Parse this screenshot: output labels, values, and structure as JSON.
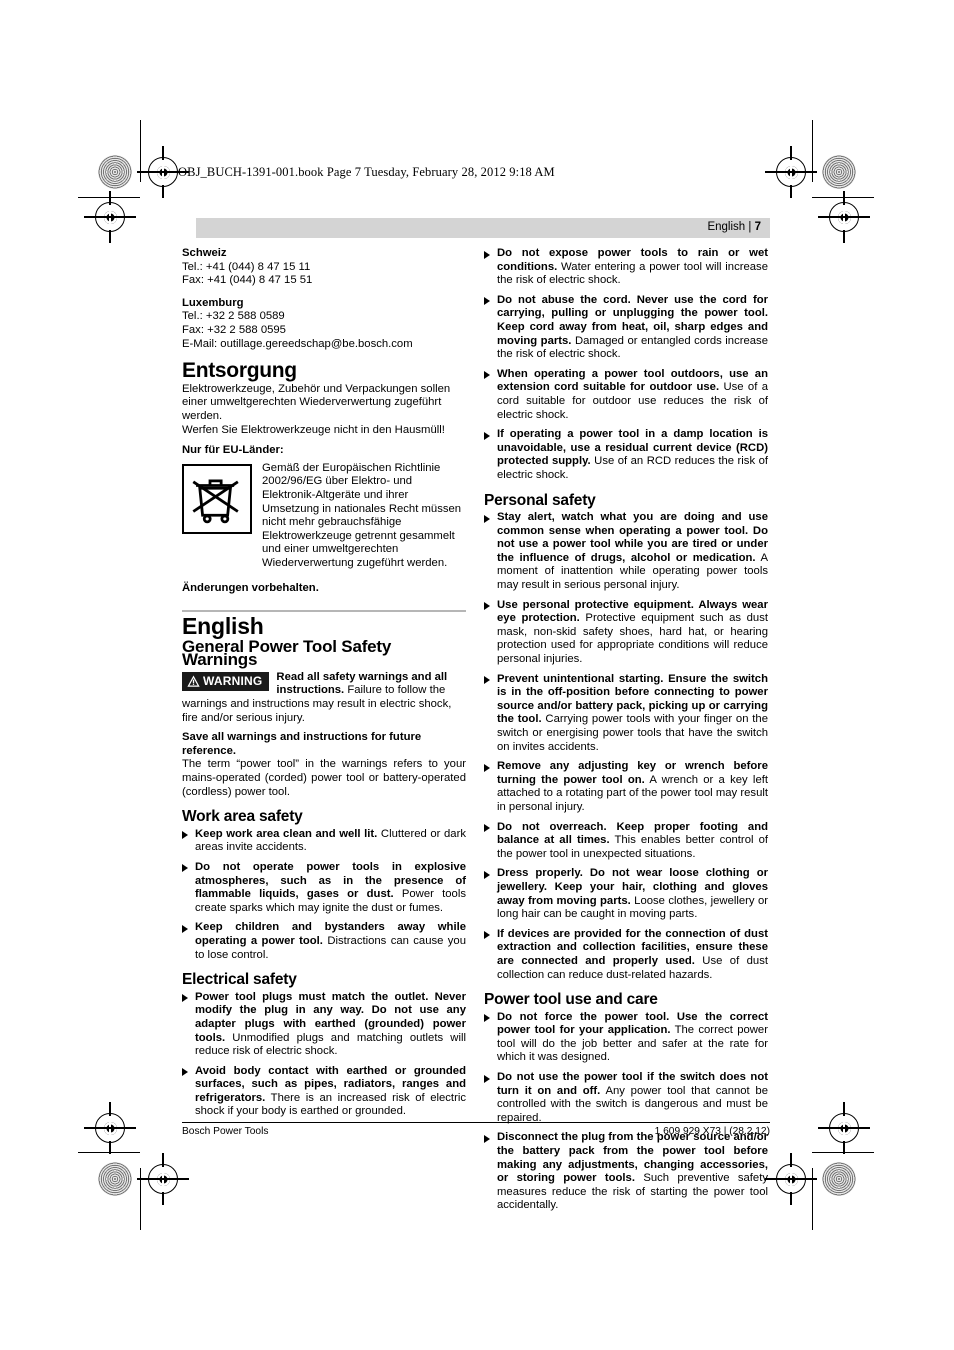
{
  "print_marks": {
    "file_label": "OBJ_BUCH-1391-001.book  Page 7  Tuesday, February 28, 2012  9:18 AM"
  },
  "header": {
    "language": "English",
    "separator": "|",
    "page_number": "7"
  },
  "footer": {
    "left": "Bosch Power Tools",
    "right": "1 609 929 X73 | (28.2.12)"
  },
  "left_column": {
    "contacts": [
      {
        "name": "Schweiz",
        "lines": [
          "Tel.: +41 (044) 8 47 15 11",
          "Fax: +41 (044) 8 47 15 51"
        ]
      },
      {
        "name": "Luxemburg",
        "lines": [
          "Tel.: +32 2 588 0589",
          "Fax: +32 2 588 0595",
          "E-Mail: outillage.gereedschap@be.bosch.com"
        ]
      }
    ],
    "entsorgung": {
      "heading": "Entsorgung",
      "paragraphs": [
        "Elektrowerkzeuge, Zubehör und Verpackungen sollen einer umweltgerechten Wiederverwertung zugeführt werden.",
        "Werfen Sie Elektrowerkzeuge nicht in den Hausmüll!"
      ],
      "eu_heading": "Nur für EU-Länder:",
      "eu_icon_name": "crossed-out-wheeled-bin-icon",
      "eu_text": "Gemäß der Europäischen Richtlinie 2002/96/EG über Elektro- und Elektronik-Altgeräte und ihrer Umsetzung in nationales Recht müssen nicht mehr gebrauchsfähige Elektrowerkzeuge getrennt gesammelt und einer umweltgerechten Wiederverwertung zugeführt werden.",
      "disclaimer": "Änderungen vorbehalten."
    },
    "english": {
      "language_heading": "English",
      "section_heading": "General Power Tool Safety Warnings",
      "warning_badge": "WARNING",
      "warning_lead": "Read all safety warnings and all instructions.",
      "warning_body": " Failure to follow the warnings and instructions may result in electric shock, fire and/or serious injury.",
      "save_lead": "Save all warnings and instructions for future reference.",
      "term_paragraph": "The term “power tool” in the warnings refers to your mains-operated (corded) power tool or battery-operated (cordless) power tool."
    },
    "work_area_safety": {
      "heading": "Work area safety",
      "items": [
        {
          "lead": "Keep work area clean and well lit.",
          "body": " Cluttered or dark areas invite accidents."
        },
        {
          "lead": "Do not operate power tools in explosive atmospheres, such as in the presence of flammable liquids, gases or dust.",
          "body": " Power tools create sparks which may ignite the dust or fumes."
        },
        {
          "lead": "Keep children and bystanders away while operating a power tool.",
          "body": " Distractions can cause you to lose control."
        }
      ]
    },
    "electrical_safety": {
      "heading": "Electrical safety",
      "items": [
        {
          "lead": "Power tool plugs must match the outlet. Never modify the plug in any way. Do not use any adapter plugs with earthed (grounded) power tools.",
          "body": " Unmodified plugs and matching outlets will reduce risk of electric shock."
        },
        {
          "lead": "Avoid body contact with earthed or grounded surfaces, such as pipes, radiators, ranges and refrigerators.",
          "body": " There is an increased risk of electric shock if your body is earthed or grounded."
        }
      ]
    }
  },
  "right_column": {
    "electrical_safety_cont": {
      "items": [
        {
          "lead": "Do not expose power tools to rain or wet conditions.",
          "body": " Water entering a power tool will increase the risk of electric shock."
        },
        {
          "lead": "Do not abuse the cord. Never use the cord for carrying, pulling or unplugging the power tool. Keep cord away from heat, oil, sharp edges and moving parts.",
          "body": " Damaged or entangled cords increase the risk of electric shock."
        },
        {
          "lead": "When operating a power tool outdoors, use an extension cord suitable for outdoor use.",
          "body": " Use of a cord suitable for outdoor use reduces the risk of electric shock."
        },
        {
          "lead": "If operating a power tool in a damp location is unavoidable, use a residual current device (RCD) protected supply.",
          "body": " Use of an RCD reduces the risk of electric shock."
        }
      ]
    },
    "personal_safety": {
      "heading": "Personal safety",
      "items": [
        {
          "lead": "Stay alert, watch what you are doing and use common sense when operating a power tool. Do not use a power tool while you are tired or under the influence of drugs, alcohol or medication.",
          "body": " A moment of inattention while operating power tools may result in serious personal injury."
        },
        {
          "lead": "Use personal protective equipment. Always wear eye protection.",
          "body": " Protective equipment such as dust mask, non-skid safety shoes, hard hat, or hearing protection used for appropriate conditions will reduce personal injuries."
        },
        {
          "lead": "Prevent unintentional starting. Ensure the switch is in the off-position before connecting to power source and/or battery pack, picking up or carrying the tool.",
          "body": " Carrying power tools with your finger on the switch or energising power tools that have the switch on invites accidents."
        },
        {
          "lead": "Remove any adjusting key or wrench before turning the power tool on.",
          "body": " A wrench or a key left attached to a rotating part of the power tool may result in personal injury."
        },
        {
          "lead": "Do not overreach. Keep proper footing and balance at all times.",
          "body": " This enables better control of the power tool in unexpected situations."
        },
        {
          "lead": "Dress properly. Do not wear loose clothing or jewellery. Keep your hair, clothing and gloves away from moving parts.",
          "body": " Loose clothes, jewellery or long hair can be caught in moving parts."
        },
        {
          "lead": "If devices are provided for the connection of dust extraction and collection facilities, ensure these are connected and properly used.",
          "body": " Use of dust collection can reduce dust-related hazards."
        }
      ]
    },
    "power_tool_use": {
      "heading": "Power tool use and care",
      "items": [
        {
          "lead": "Do not force the power tool. Use the correct power tool for your application.",
          "body": " The correct power tool will do the job better and safer at the rate for which it was designed."
        },
        {
          "lead": "Do not use the power tool if the switch does not turn it on and off.",
          "body": " Any power tool that cannot be controlled with the switch is dangerous and must be repaired."
        },
        {
          "lead": "Disconnect the plug from the power source and/or the battery pack from the power tool before making any adjustments, changing accessories, or storing power tools.",
          "body": " Such preventive safety measures reduce the risk of starting the power tool accidentally."
        }
      ]
    }
  }
}
